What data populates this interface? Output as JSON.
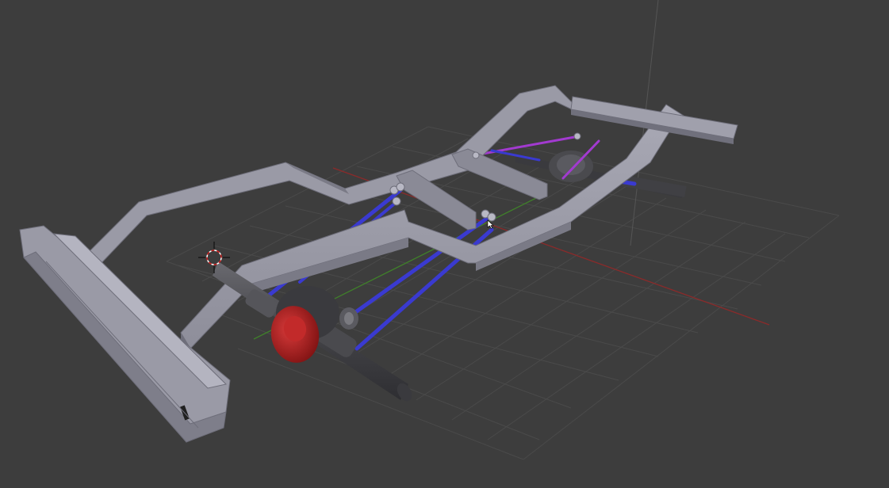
{
  "viewport": {
    "background": "#3d3d3d",
    "grid_color": "#4a4a4a",
    "x_axis_color": "#8b2a2a",
    "y_axis_color": "#3f7f2a",
    "z_axis_color": "#5a5a5a"
  },
  "scene": {
    "frame_color": "#8e8e9a",
    "frame_dark": "#6e6e7a",
    "frame_light": "#a9a9b5",
    "link_color": "#3a3ad0",
    "link_alt_color": "#a23ad0",
    "axle_color": "#4a4a4e",
    "diff_color": "#b01e1e"
  },
  "icons": {
    "cursor": "3d-cursor-icon",
    "pointer": "mouse-pointer-icon"
  }
}
